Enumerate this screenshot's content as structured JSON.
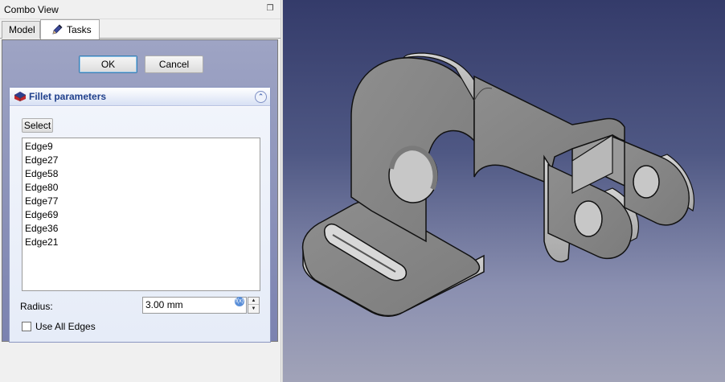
{
  "combo": {
    "title": "Combo View",
    "float_icon": "restore-icon"
  },
  "tabs": {
    "model": "Model",
    "tasks": "Tasks"
  },
  "task": {
    "ok": "OK",
    "cancel": "Cancel"
  },
  "fillet": {
    "title": "Fillet parameters",
    "icon": "fillet-icon",
    "select": "Select",
    "edges": [
      "Edge9",
      "Edge27",
      "Edge58",
      "Edge80",
      "Edge77",
      "Edge69",
      "Edge36",
      "Edge21"
    ],
    "radius_label": "Radius:",
    "radius_value": "3.00 mm",
    "use_all_label": "Use All Edges",
    "use_all_checked": false
  },
  "viewport": {
    "background_top": "#343b6a",
    "background_bottom": "#a1a3b8",
    "part_color": "#8c8c8c"
  }
}
